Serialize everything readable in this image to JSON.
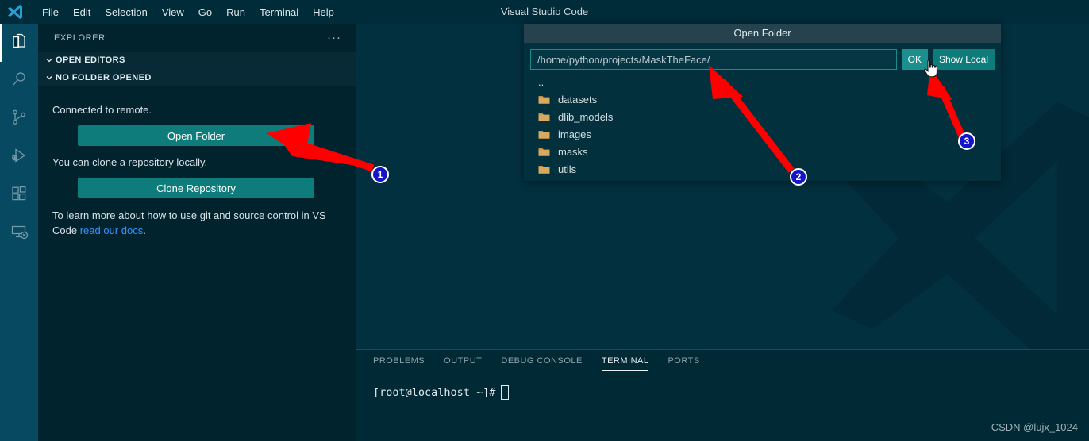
{
  "window": {
    "title": "Visual Studio Code",
    "logo_icon": "vscode-logo-icon"
  },
  "menubar": {
    "items": [
      {
        "label": "File"
      },
      {
        "label": "Edit"
      },
      {
        "label": "Selection"
      },
      {
        "label": "View"
      },
      {
        "label": "Go"
      },
      {
        "label": "Run"
      },
      {
        "label": "Terminal"
      },
      {
        "label": "Help"
      }
    ]
  },
  "activitybar": {
    "items": [
      {
        "name": "explorer",
        "icon": "files-icon",
        "active": true
      },
      {
        "name": "search",
        "icon": "search-icon",
        "active": false
      },
      {
        "name": "source-control",
        "icon": "source-control-icon",
        "active": false
      },
      {
        "name": "run-and-debug",
        "icon": "run-debug-icon",
        "active": false
      },
      {
        "name": "extensions",
        "icon": "extensions-icon",
        "active": false
      },
      {
        "name": "remote-explorer",
        "icon": "remote-explorer-icon",
        "active": false
      }
    ]
  },
  "sidebar": {
    "title": "EXPLORER",
    "more_actions": "···",
    "sections": [
      {
        "label": "OPEN EDITORS"
      },
      {
        "label": "NO FOLDER OPENED"
      }
    ],
    "connected_text": "Connected to remote.",
    "open_folder_button": "Open Folder",
    "clone_text": "You can clone a repository locally.",
    "clone_button": "Clone Repository",
    "docs_text_before": "To learn more about how to use git and source control in VS Code ",
    "docs_link": "read our docs",
    "docs_text_after": "."
  },
  "dialog": {
    "title": "Open Folder",
    "path_value": "/home/python/projects/MaskTheFace/",
    "path_placeholder": "/home/python/projects/MaskTheFace/",
    "ok_button": "OK",
    "show_local_button": "Show Local",
    "parent_entry": "..",
    "entries": [
      {
        "name": "datasets",
        "icon": "folder-icon"
      },
      {
        "name": "dlib_models",
        "icon": "folder-icon"
      },
      {
        "name": "images",
        "icon": "folder-icon"
      },
      {
        "name": "masks",
        "icon": "folder-icon"
      },
      {
        "name": "utils",
        "icon": "folder-icon"
      }
    ]
  },
  "panel": {
    "tabs": [
      {
        "label": "PROBLEMS",
        "active": false
      },
      {
        "label": "OUTPUT",
        "active": false
      },
      {
        "label": "DEBUG CONSOLE",
        "active": false
      },
      {
        "label": "TERMINAL",
        "active": true
      },
      {
        "label": "PORTS",
        "active": false
      }
    ],
    "terminal_prompt": "[root@localhost ~]#"
  },
  "annotations": {
    "markers": [
      {
        "number": "1"
      },
      {
        "number": "2"
      },
      {
        "number": "3"
      }
    ],
    "arrow_color": "#ff0000",
    "badge_color": "#1414c8"
  },
  "watermark": {
    "text": "CSDN @lujx_1024"
  },
  "theme": {
    "accent_button": "#0e7c7b",
    "editor_bg": "#03303f",
    "sidebar_bg": "#00232e",
    "activitybar_bg": "#064961",
    "titlebar_bg": "#002b38",
    "link": "#3794ff"
  }
}
